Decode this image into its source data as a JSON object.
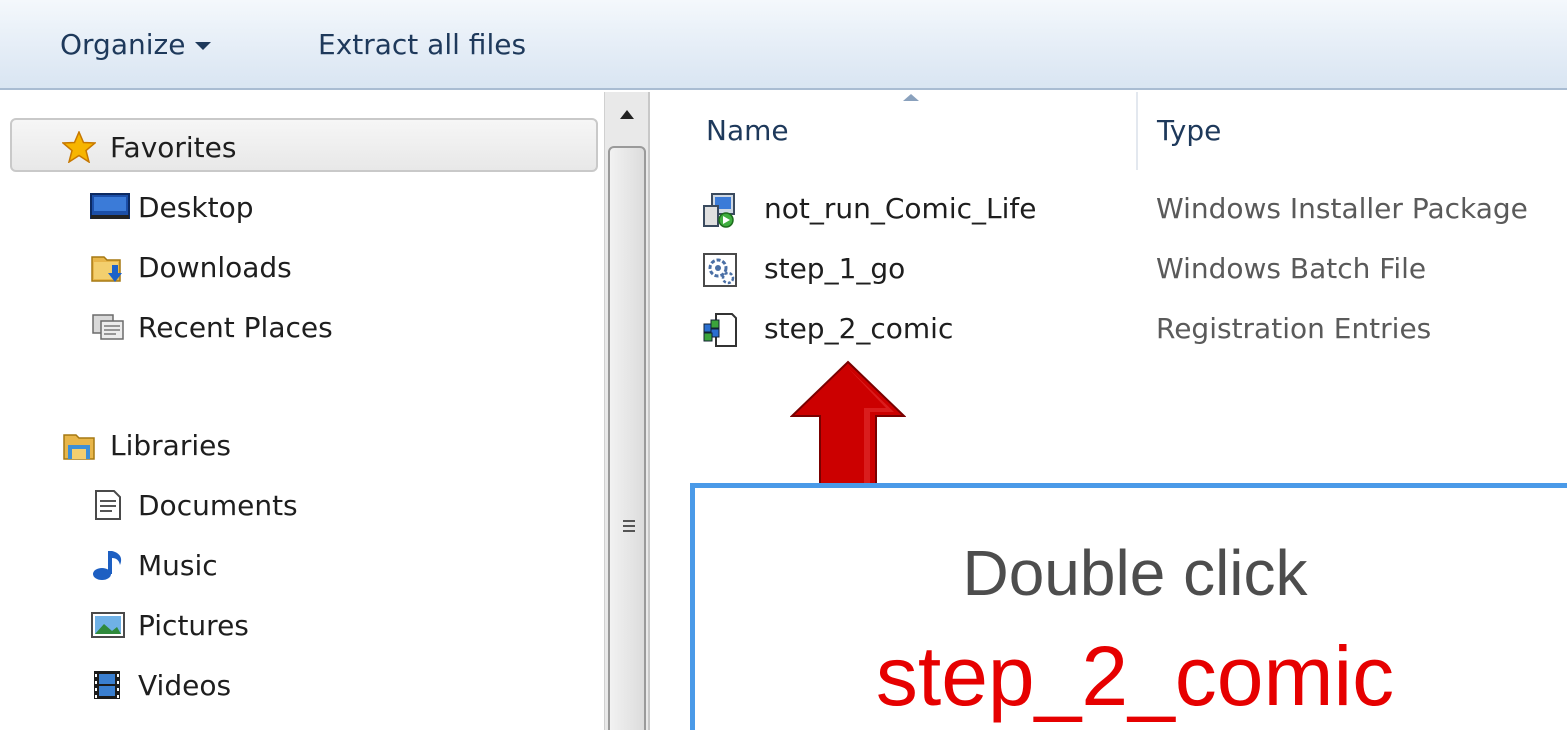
{
  "toolbar": {
    "organize_label": "Organize",
    "extract_label": "Extract all files"
  },
  "nav": {
    "favorites": {
      "label": "Favorites",
      "items": [
        {
          "label": "Desktop",
          "icon": "desktop-icon"
        },
        {
          "label": "Downloads",
          "icon": "downloads-folder-icon"
        },
        {
          "label": "Recent Places",
          "icon": "recent-places-icon"
        }
      ]
    },
    "libraries": {
      "label": "Libraries",
      "items": [
        {
          "label": "Documents",
          "icon": "document-icon"
        },
        {
          "label": "Music",
          "icon": "music-note-icon"
        },
        {
          "label": "Pictures",
          "icon": "picture-icon"
        },
        {
          "label": "Videos",
          "icon": "film-icon"
        }
      ]
    }
  },
  "columns": {
    "name": "Name",
    "type": "Type"
  },
  "files": [
    {
      "name": "not_run_Comic_Life",
      "type": "Windows Installer Package",
      "icon": "installer-package-icon"
    },
    {
      "name": "step_1_go",
      "type": "Windows Batch File",
      "icon": "batch-file-icon"
    },
    {
      "name": "step_2_comic",
      "type": "Registration Entries",
      "icon": "registry-file-icon"
    }
  ],
  "annotation": {
    "line1": "Double click",
    "line2": "step_2_comic",
    "arrow_color": "#cc0000",
    "box_border_color": "#4a9ae8",
    "highlight_color": "#e60000"
  }
}
